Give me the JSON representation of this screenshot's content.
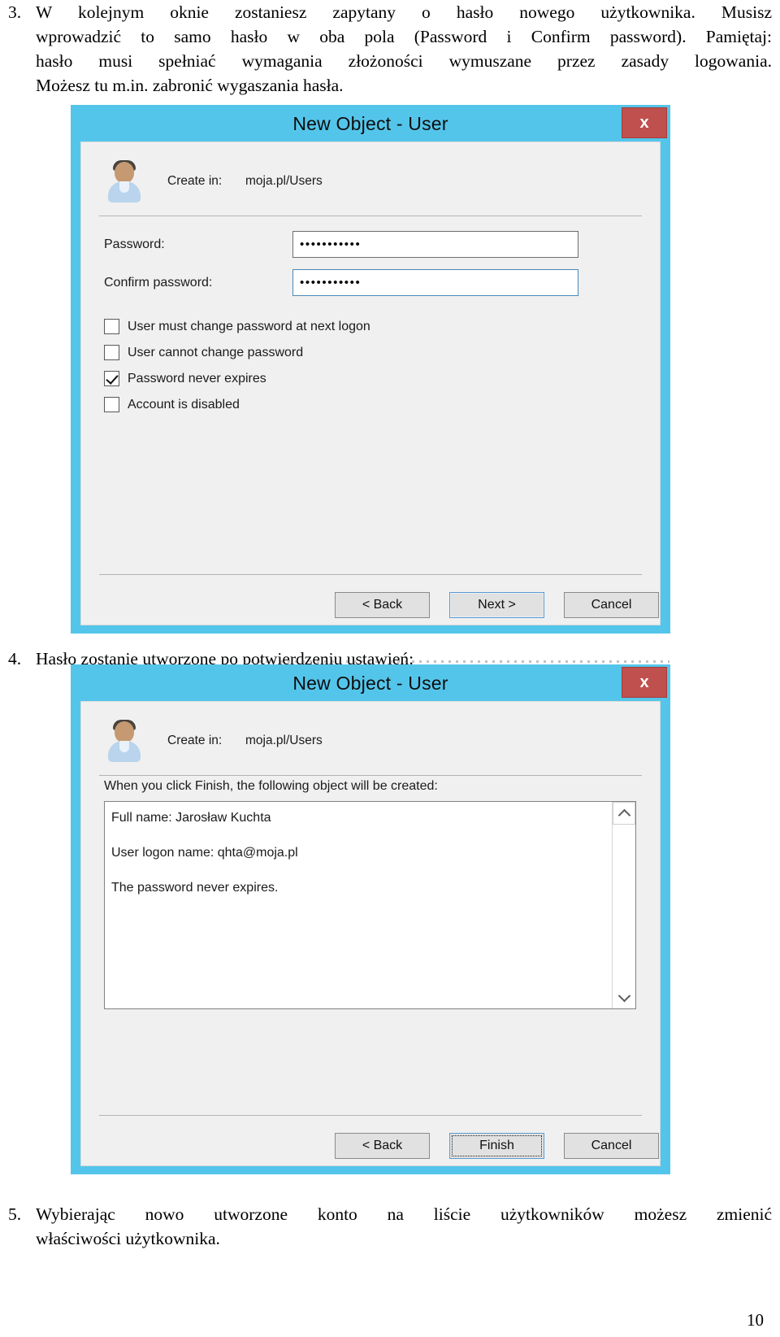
{
  "page": {
    "number": "10"
  },
  "steps": [
    {
      "number": "3.",
      "lines": [
        "W  kolejnym  oknie  zostaniesz  zapytany  o  hasło  nowego  użytkownika.  Musisz",
        "wprowadzić to samo hasło w oba pola (Password i Confirm password). Pamiętaj:",
        "hasło musi spełniać wymagania złożoności wymuszane przez zasady logowania.",
        "Możesz tu m.in. zabronić wygaszania hasła."
      ]
    },
    {
      "number": "4.",
      "lines": [
        "Hasło zostanie utworzone po potwierdzeniu ustawień:"
      ]
    },
    {
      "number": "5.",
      "lines": [
        "Wybierając  nowo  utworzone  konto  na  liście  użytkowników  możesz  zmienić",
        "właściwości użytkownika."
      ]
    }
  ],
  "dialog_password": {
    "title": "New Object - User",
    "close_label": "x",
    "avatar_name": "user-avatar-icon",
    "create_in_label": "Create in:",
    "create_in_value": "moja.pl/Users",
    "fields": [
      {
        "label": "Password:",
        "value": "•••••••••••",
        "focused": false
      },
      {
        "label": "Confirm password:",
        "value": "•••••••••••",
        "focused": true
      }
    ],
    "checkboxes": [
      {
        "label": "User must change password at next logon",
        "checked": false
      },
      {
        "label": "User cannot change password",
        "checked": false
      },
      {
        "label": "Password never expires",
        "checked": true
      },
      {
        "label": "Account is disabled",
        "checked": false
      }
    ],
    "buttons": [
      {
        "label": "< Back",
        "style": "normal"
      },
      {
        "label": "Next >",
        "style": "default"
      },
      {
        "label": "Cancel",
        "style": "normal"
      }
    ]
  },
  "dialog_finish": {
    "title": "New Object - User",
    "close_label": "x",
    "avatar_name": "user-avatar-icon",
    "create_in_label": "Create in:",
    "create_in_value": "moja.pl/Users",
    "summary_intro": "When you click Finish, the following object will be created:",
    "summary_lines": [
      "Full name: Jarosław Kuchta",
      "User logon name: qhta@moja.pl",
      "The password never expires."
    ],
    "scroll_up_icon": "chevron-up-icon",
    "scroll_down_icon": "chevron-down-icon",
    "buttons": [
      {
        "label": "< Back",
        "style": "normal"
      },
      {
        "label": "Finish",
        "style": "focusring"
      },
      {
        "label": "Cancel",
        "style": "normal"
      }
    ]
  },
  "colors": {
    "window_frame": "#54c5ea",
    "close_button": "#c0504d",
    "client_bg": "#f0f0f0",
    "accent_focus": "#5b9bd0"
  }
}
